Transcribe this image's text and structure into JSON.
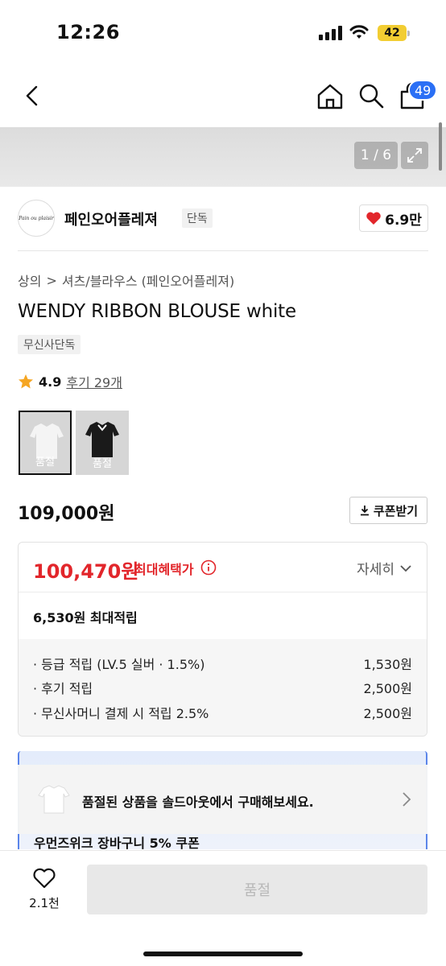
{
  "status_bar": {
    "time": "12:26",
    "battery": "42"
  },
  "header": {
    "cart_count": "49"
  },
  "gallery": {
    "page_indicator": "1 / 6"
  },
  "brand": {
    "logo_text": "Pain ou plaisir",
    "name": "페인오어플레져",
    "tag": "단독",
    "likes": "6.9만"
  },
  "breadcrumb": {
    "category": "상의",
    "separator": ">",
    "subcategory": "셔츠/블라우스 (페인오어플레져)"
  },
  "product": {
    "title": "WENDY RIBBON BLOUSE white",
    "exclusive_tag": "무신사단독",
    "rating": "4.9",
    "review_link": "후기 29개"
  },
  "options": [
    {
      "label": "품절",
      "color": "white"
    },
    {
      "label": "품절",
      "color": "black"
    }
  ],
  "price": {
    "original": "109,000원",
    "coupon_button": "쿠폰받기"
  },
  "benefit": {
    "max_price": "100,470원",
    "max_label": "최대혜택가",
    "detail_toggle": "자세히",
    "points_total": "6,530원 최대적립",
    "points": [
      {
        "label": "· 등급 적립 (LV.5 실버 · 1.5%)",
        "value": "1,530원"
      },
      {
        "label": "· 후기 적립",
        "value": "2,500원"
      },
      {
        "label": "· 무신사머니 결제 시 적립 2.5%",
        "value": "2,500원"
      }
    ]
  },
  "soldout_banner": {
    "text": "품절된 상품을 솔드아웃에서 구매해보세요."
  },
  "promo_peek": {
    "text": "우먼즈위크 장바구니 5% 쿠폰"
  },
  "bottom_bar": {
    "likes": "2.1천",
    "buy_button": "품절"
  },
  "colors": {
    "accent_red": "#e2262b",
    "badge_blue": "#2a6ff5",
    "heart_red": "#e2262b"
  }
}
